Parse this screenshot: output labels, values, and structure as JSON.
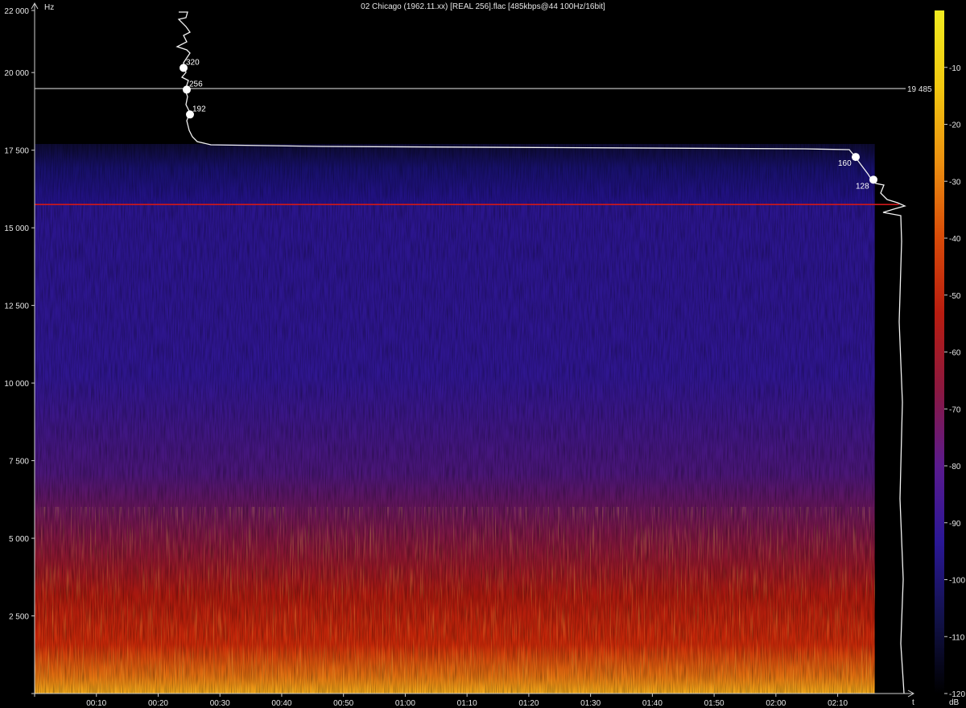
{
  "title": "02 Chicago (1962.11.xx) [REAL 256].flac [485kbps@44 100Hz/16bit]",
  "chart_data": {
    "type": "heatmap",
    "xlabel": "t",
    "ylabel": "Hz",
    "ylim": [
      0,
      22000
    ],
    "xlim_seconds": [
      0,
      141
    ],
    "y_ticks": [
      {
        "value": 2500,
        "label": "2 500"
      },
      {
        "value": 5000,
        "label": "5 000"
      },
      {
        "value": 7500,
        "label": "7 500"
      },
      {
        "value": 10000,
        "label": "10 000"
      },
      {
        "value": 12500,
        "label": "12 500"
      },
      {
        "value": 15000,
        "label": "15 000"
      },
      {
        "value": 17500,
        "label": "17 500"
      },
      {
        "value": 20000,
        "label": "20 000"
      },
      {
        "value": 22000,
        "label": "22 000"
      }
    ],
    "x_ticks": [
      {
        "value": 10,
        "label": "00:10"
      },
      {
        "value": 20,
        "label": "00:20"
      },
      {
        "value": 30,
        "label": "00:30"
      },
      {
        "value": 40,
        "label": "00:40"
      },
      {
        "value": 50,
        "label": "00:50"
      },
      {
        "value": 60,
        "label": "01:00"
      },
      {
        "value": 70,
        "label": "01:10"
      },
      {
        "value": 80,
        "label": "01:20"
      },
      {
        "value": 90,
        "label": "01:30"
      },
      {
        "value": 100,
        "label": "01:40"
      },
      {
        "value": 110,
        "label": "01:50"
      },
      {
        "value": 120,
        "label": "02:00"
      },
      {
        "value": 130,
        "label": "02:10"
      }
    ],
    "colorbar": {
      "unit": "dB",
      "range": [
        -120,
        0
      ],
      "ticks": [
        {
          "value": -10,
          "label": "-10"
        },
        {
          "value": -20,
          "label": "-20"
        },
        {
          "value": -30,
          "label": "-30"
        },
        {
          "value": -40,
          "label": "-40"
        },
        {
          "value": -50,
          "label": "-50"
        },
        {
          "value": -60,
          "label": "-60"
        },
        {
          "value": -70,
          "label": "-70"
        },
        {
          "value": -80,
          "label": "-80"
        },
        {
          "value": -90,
          "label": "-90"
        },
        {
          "value": -100,
          "label": "-100"
        },
        {
          "value": -110,
          "label": "-110"
        },
        {
          "value": -120,
          "label": "-120"
        }
      ],
      "colors": [
        "#000000",
        "#12124a",
        "#2a1796",
        "#5a1a8e",
        "#8a1840",
        "#b81c10",
        "#d84a08",
        "#ec9010",
        "#f2c810",
        "#f2ec20"
      ]
    },
    "spectrum_cutoff_hz": 17700,
    "content_end_seconds": 136,
    "reference_lines": [
      {
        "value": 19485,
        "label": "19 485",
        "color": "#cfcfcf"
      },
      {
        "value": 15750,
        "label": "",
        "color": "#d01818"
      }
    ],
    "bitrate_markers": [
      {
        "label": "320",
        "freq": 20150,
        "position": "top-left"
      },
      {
        "label": "256",
        "freq": 19450,
        "position": "top-left"
      },
      {
        "label": "192",
        "freq": 18650,
        "position": "top-left"
      },
      {
        "label": "160",
        "freq": 17280,
        "position": "top-right"
      },
      {
        "label": "128",
        "freq": 16550,
        "position": "top-right"
      }
    ]
  }
}
